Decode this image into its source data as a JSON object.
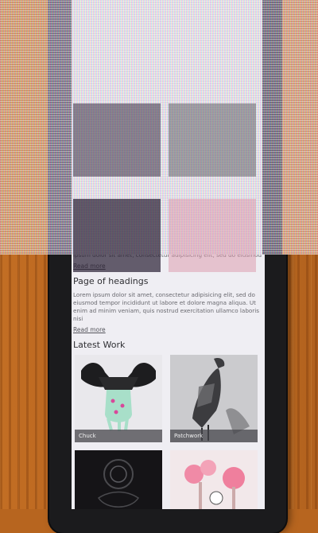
{
  "page": {
    "intro_text": "ipsum dolor sit amet, consectetur adipisicing elit, sed do eiusmod",
    "read_more_1": "Read more",
    "section_heading": "Page of headings",
    "section_text": "Lorem ipsum dolor sit amet, consectetur adipisicing elit, sed do eiusmod tempor incididunt ut labore et dolore magna aliqua. Ut enim ad minim veniam, quis nostrud exercitation ullamco laboris nisi",
    "read_more_2": "Read more",
    "latest_heading": "Latest Work",
    "tiles": [
      {
        "caption": "Chuck",
        "icon": "hands-illustration"
      },
      {
        "caption": "Patchwork",
        "icon": "bird-illustration"
      },
      {
        "caption": "",
        "icon": "dark-floral-illustration"
      },
      {
        "caption": "",
        "icon": "pink-trees-illustration"
      }
    ]
  }
}
